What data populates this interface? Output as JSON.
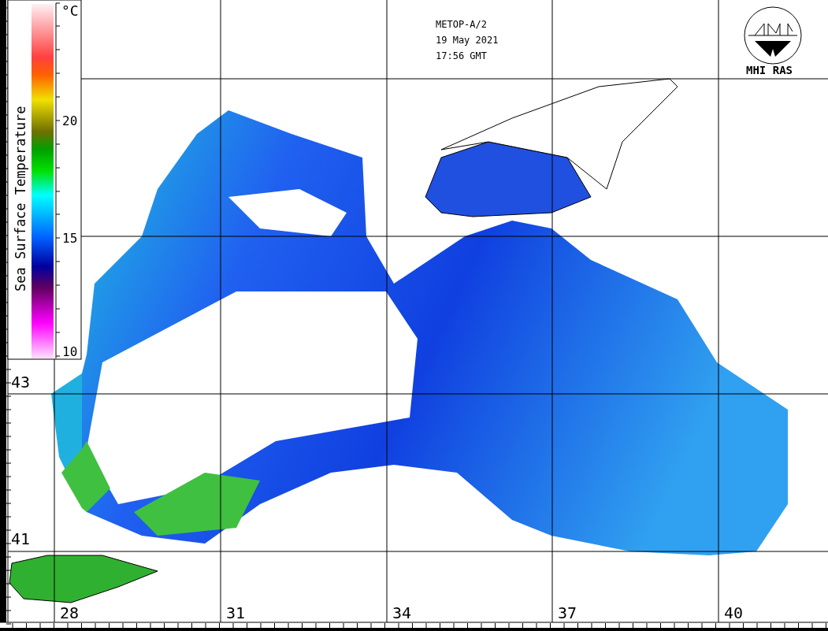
{
  "satellite_info": {
    "satellite": "METOP-A/2",
    "date": "19 May 2021",
    "time": "17:56 GMT"
  },
  "logo": {
    "text": "MHI RAS"
  },
  "color_scale": {
    "title": "Sea Surface Temperature",
    "unit": "°C",
    "ticks": [
      "20",
      "15",
      "10"
    ]
  },
  "latitude_labels": [
    "43",
    "41"
  ],
  "longitude_labels": [
    "28",
    "31",
    "34",
    "37",
    "40"
  ]
}
